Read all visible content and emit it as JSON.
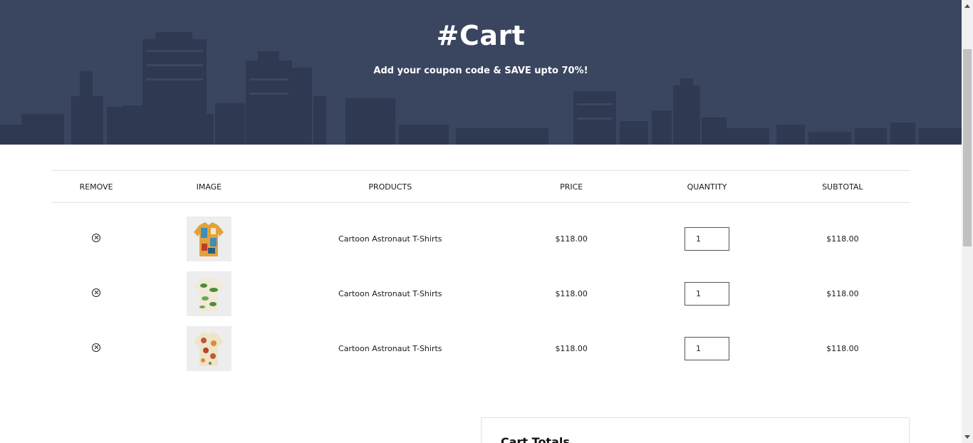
{
  "hero": {
    "title": "#Cart",
    "subtitle": "Add your coupon code & SAVE upto 70%!"
  },
  "table": {
    "headers": {
      "remove": "REMOVE",
      "image": "IMAGE",
      "products": "PRODUCTS",
      "price": "PRICE",
      "quantity": "QUANTITY",
      "subtotal": "SUBTOTAL"
    },
    "rows": [
      {
        "product": "Cartoon Astronaut T-Shirts",
        "price": "$118.00",
        "quantity": "1",
        "subtotal": "$118.00",
        "image": "patterned-shirt-yellow-blue"
      },
      {
        "product": "Cartoon Astronaut T-Shirts",
        "price": "$118.00",
        "quantity": "1",
        "subtotal": "$118.00",
        "image": "tropical-leaf-shirt"
      },
      {
        "product": "Cartoon Astronaut T-Shirts",
        "price": "$118.00",
        "quantity": "1",
        "subtotal": "$118.00",
        "image": "floral-shirt-cream"
      }
    ]
  },
  "totals": {
    "title": "Cart Totals"
  },
  "colors": {
    "hero_bg": "#3a4560",
    "border": "#e2e2e2"
  }
}
